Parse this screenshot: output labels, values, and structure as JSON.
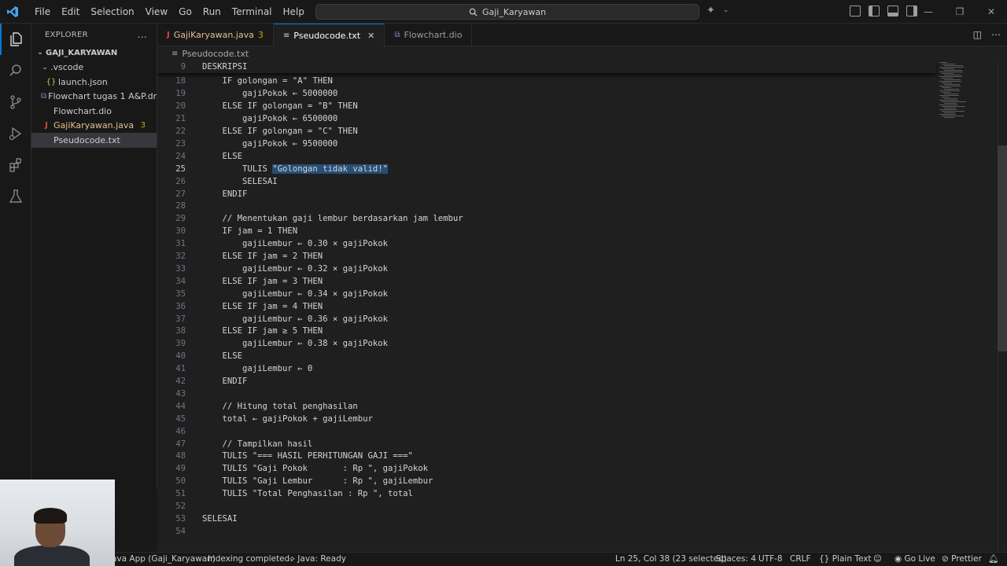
{
  "titlebar": {
    "menu": [
      "File",
      "Edit",
      "Selection",
      "View",
      "Go",
      "Run",
      "Terminal",
      "Help"
    ],
    "search_text": "Gaji_Karyawan"
  },
  "sidebar": {
    "title": "EXPLORER",
    "more": "...",
    "root": "GAJI_KARYAWAN",
    "items": [
      {
        "label": ".vscode",
        "icon": "chevron-down",
        "indent": 1
      },
      {
        "label": "launch.json",
        "icon": "json-braces",
        "indent": 2
      },
      {
        "label": "Flowchart tugas 1 A&P.dr...",
        "icon": "drawio",
        "indent": 1
      },
      {
        "label": "Flowchart.dio",
        "icon": "none",
        "indent": 1
      },
      {
        "label": "GajiKaryawan.java",
        "icon": "java",
        "indent": 1,
        "badge": "3"
      },
      {
        "label": "Pseudocode.txt",
        "icon": "text",
        "indent": 1
      }
    ]
  },
  "tabs": [
    {
      "label": "GajiKaryawan.java",
      "badge": "3",
      "icon": "java"
    },
    {
      "label": "Pseudocode.txt",
      "icon": "text",
      "active": true,
      "close": "✕"
    },
    {
      "label": "Flowchart.dio",
      "icon": "drawio"
    }
  ],
  "breadcrumb": "Pseudocode.txt",
  "editor": {
    "sticky": {
      "num": "9",
      "text": "DESKRIPSI"
    },
    "lines": [
      {
        "num": "18",
        "text": "    IF golongan = \"A\" THEN"
      },
      {
        "num": "19",
        "text": "        gajiPokok ← 5000000"
      },
      {
        "num": "20",
        "text": "    ELSE IF golongan = \"B\" THEN"
      },
      {
        "num": "21",
        "text": "        gajiPokok ← 6500000"
      },
      {
        "num": "22",
        "text": "    ELSE IF golongan = \"C\" THEN"
      },
      {
        "num": "23",
        "text": "        gajiPokok ← 9500000"
      },
      {
        "num": "24",
        "text": "    ELSE"
      },
      {
        "num": "25",
        "text": "        TULIS ",
        "sel": "\"Golongan tidak valid!\""
      },
      {
        "num": "26",
        "text": "        SELESAI"
      },
      {
        "num": "27",
        "text": "    ENDIF"
      },
      {
        "num": "28",
        "text": ""
      },
      {
        "num": "29",
        "text": "    // Menentukan gaji lembur berdasarkan jam lembur"
      },
      {
        "num": "30",
        "text": "    IF jam = 1 THEN"
      },
      {
        "num": "31",
        "text": "        gajiLembur ← 0.30 × gajiPokok"
      },
      {
        "num": "32",
        "text": "    ELSE IF jam = 2 THEN"
      },
      {
        "num": "33",
        "text": "        gajiLembur ← 0.32 × gajiPokok"
      },
      {
        "num": "34",
        "text": "    ELSE IF jam = 3 THEN"
      },
      {
        "num": "35",
        "text": "        gajiLembur ← 0.34 × gajiPokok"
      },
      {
        "num": "36",
        "text": "    ELSE IF jam = 4 THEN"
      },
      {
        "num": "37",
        "text": "        gajiLembur ← 0.36 × gajiPokok"
      },
      {
        "num": "38",
        "text": "    ELSE IF jam ≥ 5 THEN"
      },
      {
        "num": "39",
        "text": "        gajiLembur ← 0.38 × gajiPokok"
      },
      {
        "num": "40",
        "text": "    ELSE"
      },
      {
        "num": "41",
        "text": "        gajiLembur ← 0"
      },
      {
        "num": "42",
        "text": "    ENDIF"
      },
      {
        "num": "43",
        "text": ""
      },
      {
        "num": "44",
        "text": "    // Hitung total penghasilan"
      },
      {
        "num": "45",
        "text": "    total ← gajiPokok + gajiLembur"
      },
      {
        "num": "46",
        "text": ""
      },
      {
        "num": "47",
        "text": "    // Tampilkan hasil"
      },
      {
        "num": "48",
        "text": "    TULIS \"=== HASIL PERHITUNGAN GAJI ===\""
      },
      {
        "num": "49",
        "text": "    TULIS \"Gaji Pokok       : Rp \", gajiPokok"
      },
      {
        "num": "50",
        "text": "    TULIS \"Gaji Lembur      : Rp \", gajiLembur"
      },
      {
        "num": "51",
        "text": "    TULIS \"Total Penghasilan : Rp \", total"
      },
      {
        "num": "52",
        "text": ""
      },
      {
        "num": "53",
        "text": "SELESAI"
      },
      {
        "num": "54",
        "text": ""
      }
    ],
    "current_line": "25"
  },
  "statusbar": {
    "java_app": "ava App (Gaji_Karyawan)",
    "indexing": "Indexing completed.",
    "java_ready": "Java: Ready",
    "position": "Ln 25, Col 38 (23 selected)",
    "spaces": "Spaces: 4",
    "encoding": "UTF-8",
    "eol": "CRLF",
    "language": "Plain Text",
    "golive": "Go Live",
    "prettier": "Prettier"
  },
  "colors": {
    "accent": "#0078d4",
    "warning": "#cca700",
    "selection": "#264f78"
  }
}
